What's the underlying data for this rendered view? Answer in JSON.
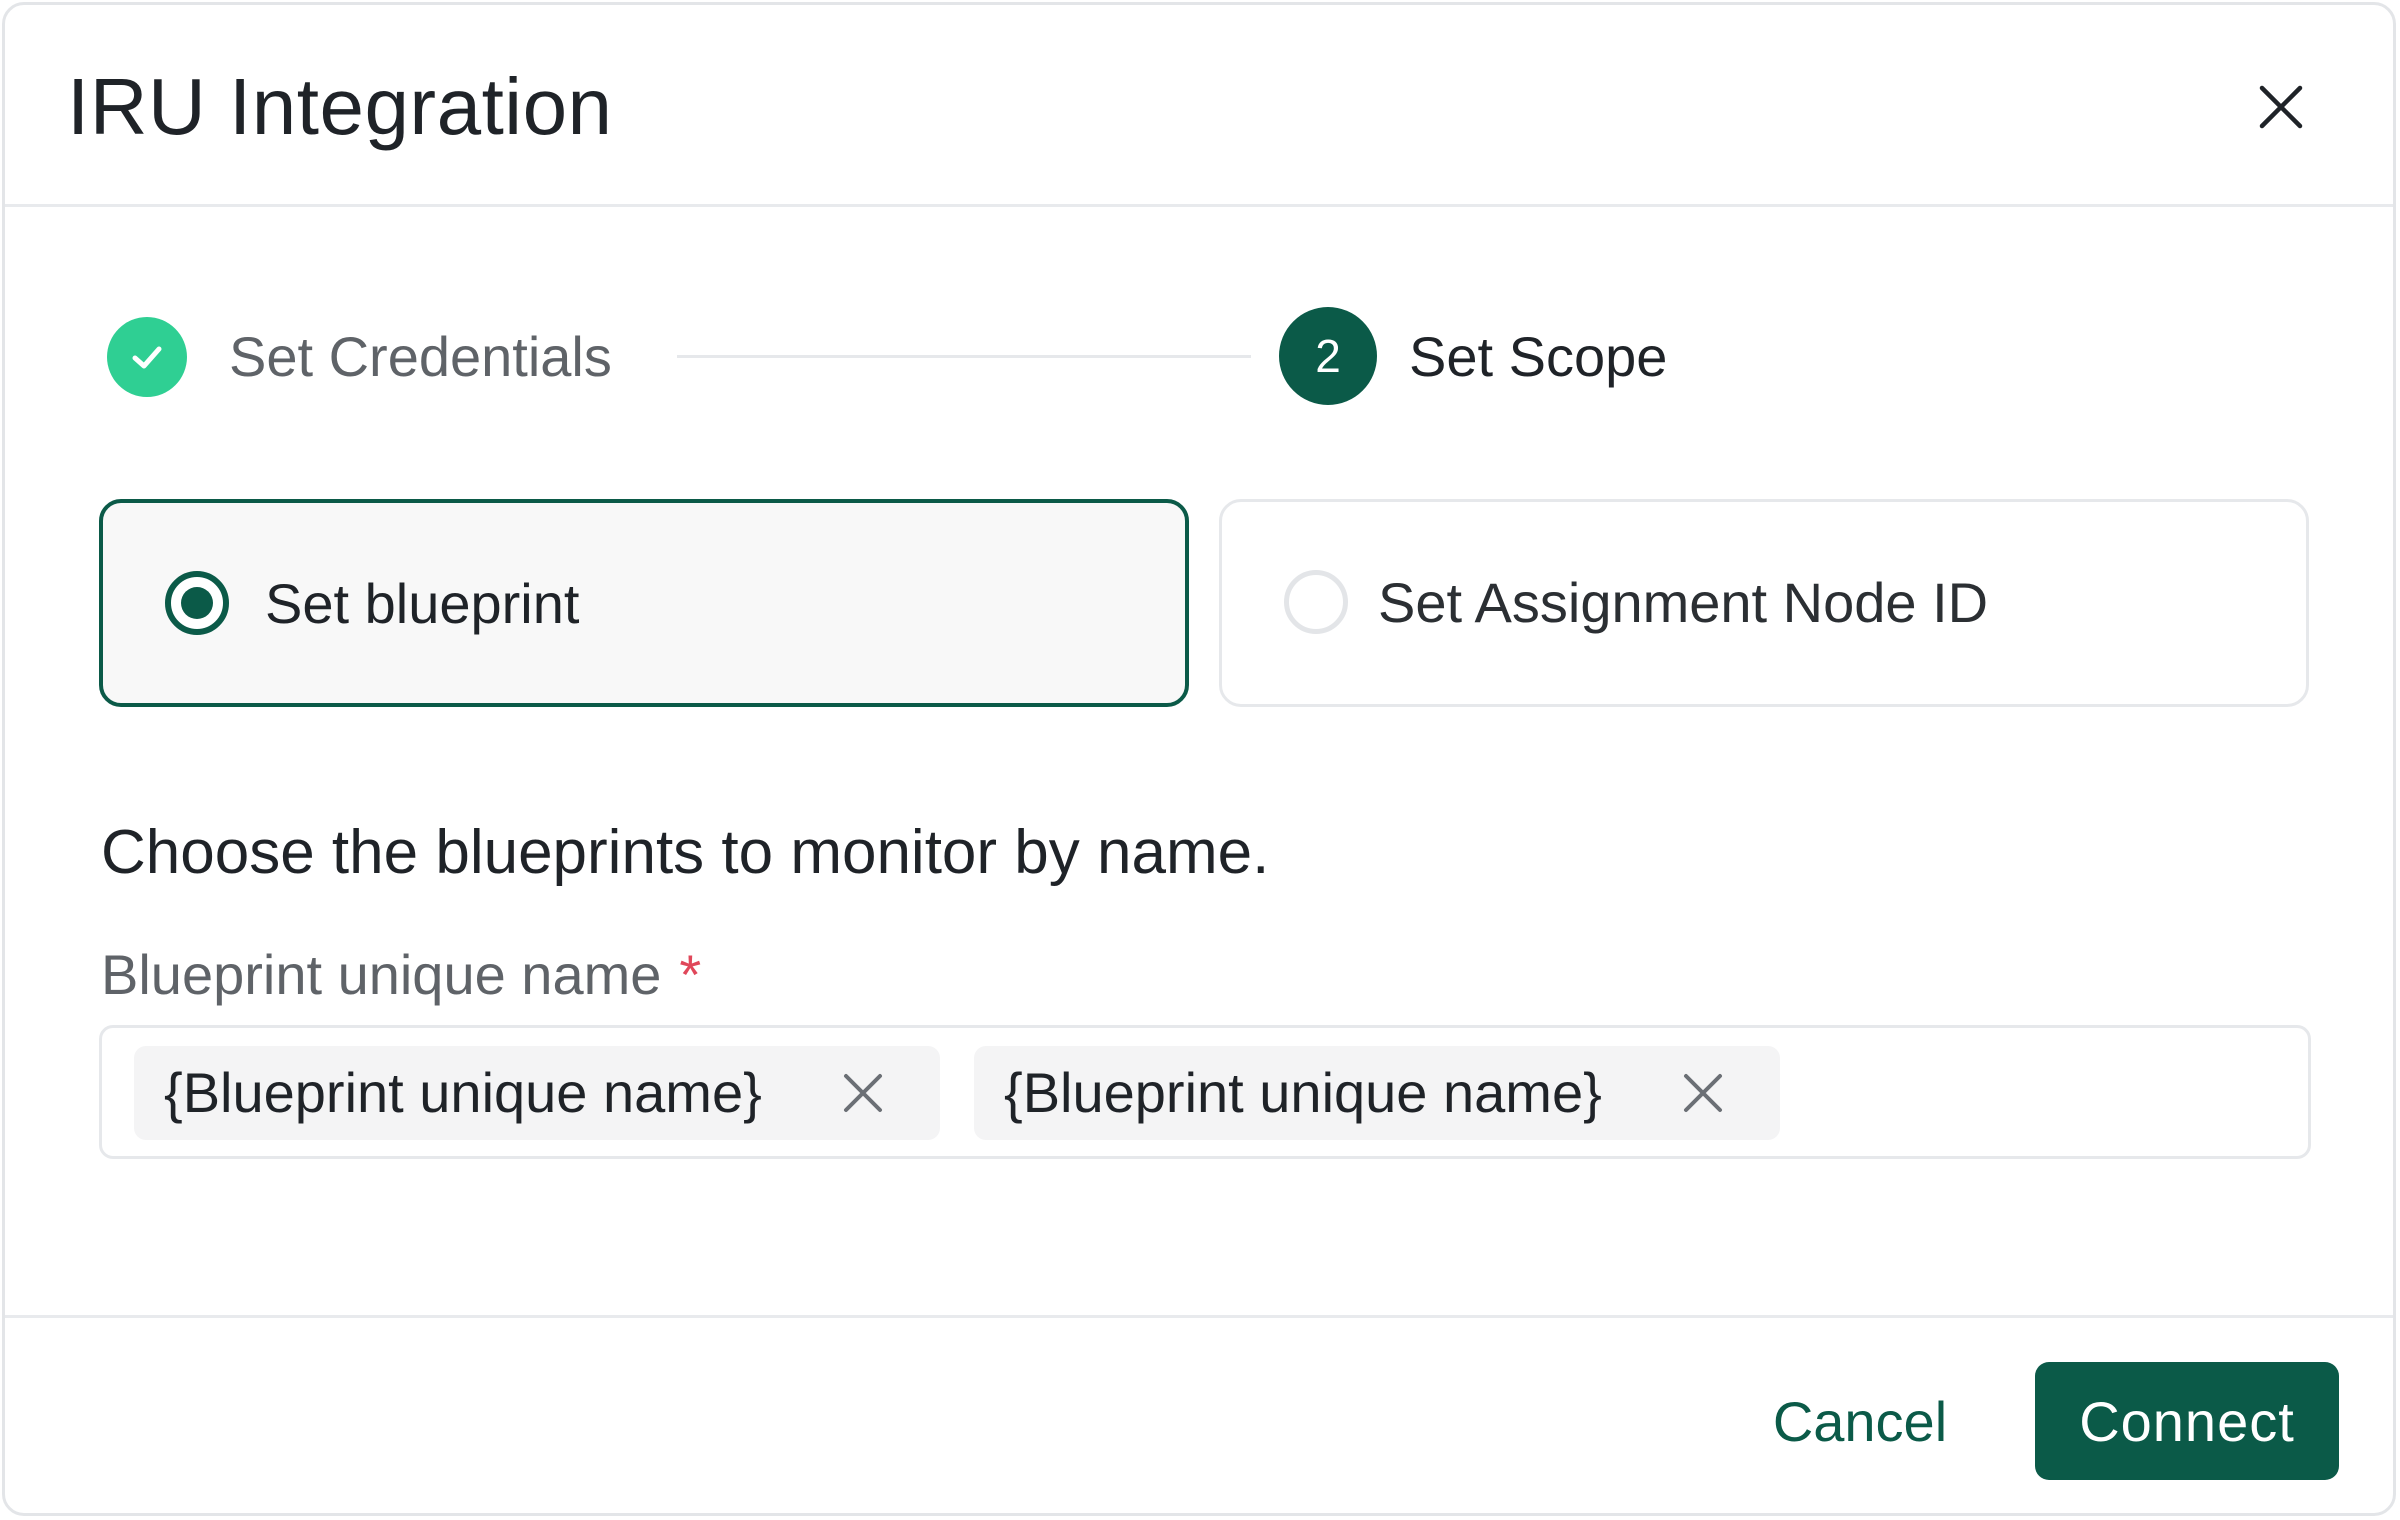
{
  "dialog": {
    "title": "IRU Integration"
  },
  "stepper": {
    "steps": [
      {
        "label": "Set Credentials",
        "state": "completed"
      },
      {
        "number": "2",
        "label": "Set Scope",
        "state": "active"
      }
    ]
  },
  "scope_options": [
    {
      "label": "Set blueprint",
      "selected": true
    },
    {
      "label": "Set Assignment Node ID",
      "selected": false
    }
  ],
  "form": {
    "description": "Choose the blueprints to monitor by name.",
    "field_label": "Blueprint unique name",
    "required_mark": "*",
    "tags": [
      "{Blueprint unique name}",
      "{Blueprint unique name}"
    ]
  },
  "footer": {
    "cancel_label": "Cancel",
    "connect_label": "Connect"
  },
  "colors": {
    "primary": "#0b5a48",
    "success": "#2fcf93",
    "required": "#e0475a",
    "border": "#e6e8eb"
  },
  "icons": {
    "close": "close-icon",
    "step_complete": "check-icon",
    "chip_remove": "close-icon"
  }
}
